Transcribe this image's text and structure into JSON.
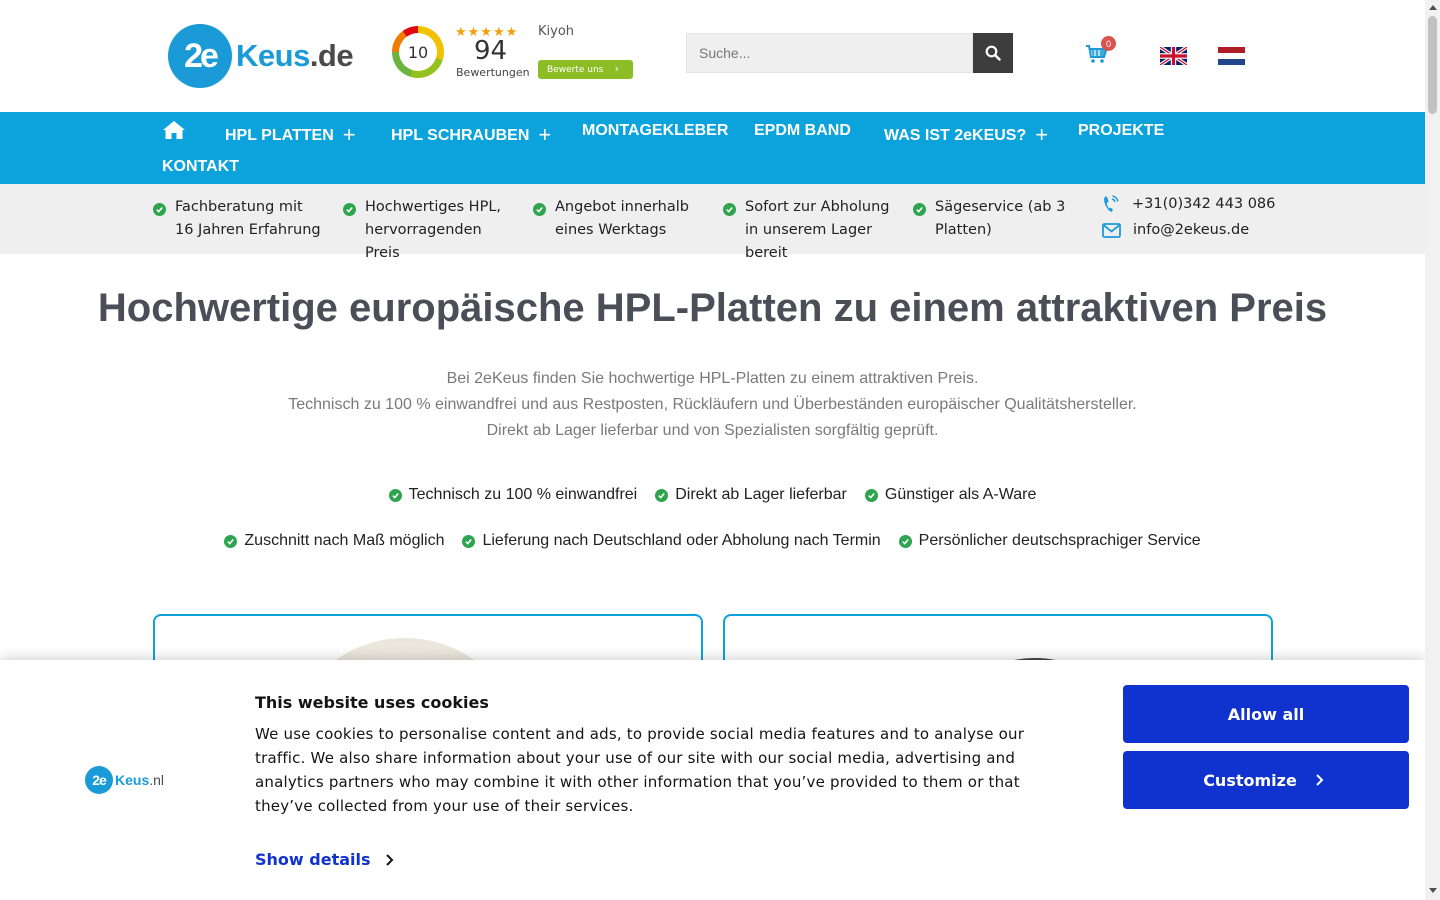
{
  "header": {
    "logo": {
      "mark": "2e",
      "name": "Keus",
      "tld": ".de"
    },
    "kiyoh": {
      "score": "10",
      "stars": "★★★★★",
      "brand": "Kiyoh",
      "count": "94",
      "count_label": "Bewertungen",
      "rate_button": "Bewerte uns"
    },
    "search": {
      "placeholder": "Suche...",
      "icon": "search-icon"
    },
    "cart": {
      "count": "0",
      "icon": "cart-icon"
    },
    "languages": [
      "English",
      "Nederlands"
    ]
  },
  "nav": {
    "items": [
      {
        "label": "",
        "icon": "home-icon"
      },
      {
        "label": "HPL PLATTEN",
        "plus": "+"
      },
      {
        "label": "HPL SCHRAUBEN",
        "plus": "+"
      },
      {
        "label": "MONTAGEKLEBER"
      },
      {
        "label": "EPDM BAND"
      },
      {
        "label": "WAS IST 2eKEUS?",
        "plus": "+"
      },
      {
        "label": "PROJEKTE"
      },
      {
        "label": "KONTAKT"
      }
    ]
  },
  "usp": {
    "items": [
      "Fachberatung mit 16 Jahren Erfahrung",
      "Hochwertiges HPL, hervorragenden Preis",
      "Angebot innerhalb eines Werktags",
      "Sofort zur Abholung in unserem Lager bereit",
      "Sägeservice (ab 3 Platten)"
    ],
    "phone": "+31(0)342 443 086",
    "email": "info@2ekeus.de"
  },
  "main": {
    "title": "Hochwertige europäische HPL-Platten zu einem attraktiven Preis",
    "subtitle_lines": [
      "Bei 2eKeus finden Sie hochwertige HPL-Platten zu einem attraktiven Preis.",
      "Technisch zu 100 % einwandfrei und aus Restposten, Rückläufern und Überbeständen europäischer Qualitätshersteller.",
      "Direkt ab Lager lieferbar und von Spezialisten sorgfältig geprüft."
    ],
    "features_row1": [
      "Technisch zu 100 % einwandfrei",
      "Direkt ab Lager lieferbar",
      "Günstiger als A-Ware"
    ],
    "features_row2": [
      "Zuschnitt nach Maß möglich",
      "Lieferung nach Deutschland oder Abholung nach Termin",
      "Persönlicher deutschsprachiger Service"
    ]
  },
  "cookie": {
    "logo": {
      "mark": "2e",
      "name": "Keus",
      "tld": ".nl"
    },
    "title": "This website uses cookies",
    "text": "We use cookies to personalise content and ads, to provide social media features and to analyse our traffic. We also share information about your use of our site with our social media, advertising and analytics partners who may combine it with other information that you’ve provided to them or that they’ve collected from your use of their services.",
    "details_label": "Show details",
    "allow_label": "Allow all",
    "customize_label": "Customize"
  },
  "colors": {
    "brand_blue": "#0ca3dd",
    "cookie_blue": "#1032cf",
    "check_green": "#2fa44f",
    "kiyoh_green": "#8dbd24"
  }
}
